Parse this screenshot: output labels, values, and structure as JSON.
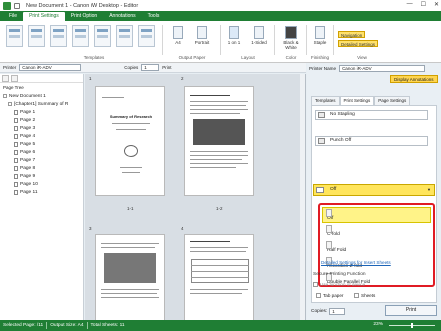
{
  "window": {
    "title": "New Document 1 - Canon iW Desktop - Editor"
  },
  "ribbon_tabs": [
    "File",
    "Print Settings",
    "Print Option",
    "Annotations",
    "Tools"
  ],
  "ribbon": {
    "templates_label": "Templates",
    "output_paper": {
      "size": "A4",
      "orientation": "Portrait",
      "label": "Output Paper"
    },
    "layout": {
      "pages": "1 on 1",
      "sides": "1-Sided",
      "label": "Layout"
    },
    "color": {
      "mode": "Black & White",
      "label": "Color"
    },
    "staple": {
      "mode": "Staple",
      "label": "Finishing"
    },
    "view": {
      "navigation": "Navigation",
      "detailed": "Detailed Settings",
      "label": "View"
    }
  },
  "toolbar": {
    "printer_label": "Printer",
    "printer_value": "Canon iR-ADV",
    "copies_label": "Copies",
    "copies_value": "1",
    "print_label": "Print"
  },
  "tree": {
    "title": "Page Tree",
    "root": "New Document 1",
    "chapter": "[Chapter1] Summary of R",
    "pages": [
      "Page 1",
      "Page 2",
      "Page 3",
      "Page 4",
      "Page 5",
      "Page 6",
      "Page 7",
      "Page 8",
      "Page 9",
      "Page 10",
      "Page 11"
    ]
  },
  "pages_view": {
    "sheet_numbers": [
      "1",
      "2",
      "3",
      "4"
    ],
    "captions": [
      "1-1",
      "1-2"
    ],
    "page1_heading": "Summary of Research"
  },
  "right_panel": {
    "printer_label": "Printer Name",
    "printer_value": "Canon iR-ADV",
    "display_annotations": "Display Annotations",
    "tabs": [
      "Templates",
      "Print Settings",
      "Page Settings"
    ],
    "active_tab": "Print Settings",
    "stapling": "No Stapling",
    "punch": "Punch Off",
    "fold_selected": "Off",
    "fold_options": [
      "Off",
      "C-fold",
      "Half Fold",
      "Accordion Z-fold",
      "Double Parallel Fold"
    ],
    "tab_paper": "Tab paper",
    "sheets": "Sheets",
    "insert_link": "Detailed Settings for Insert Sheets",
    "secure_title": "Secure Printing Function",
    "secure_option": "Use function of device",
    "copies_label": "Copies:",
    "copies_value": "1",
    "print_button": "Print"
  },
  "status": {
    "selected_page": "Selected Page: /11",
    "output_size": "Output Size: A4",
    "total_sheets": "Total Sheets: 11",
    "zoom": "23%"
  },
  "colors": {
    "brand": "#1f7e34",
    "highlight": "#ffe55c",
    "callout": "#e01b24"
  }
}
